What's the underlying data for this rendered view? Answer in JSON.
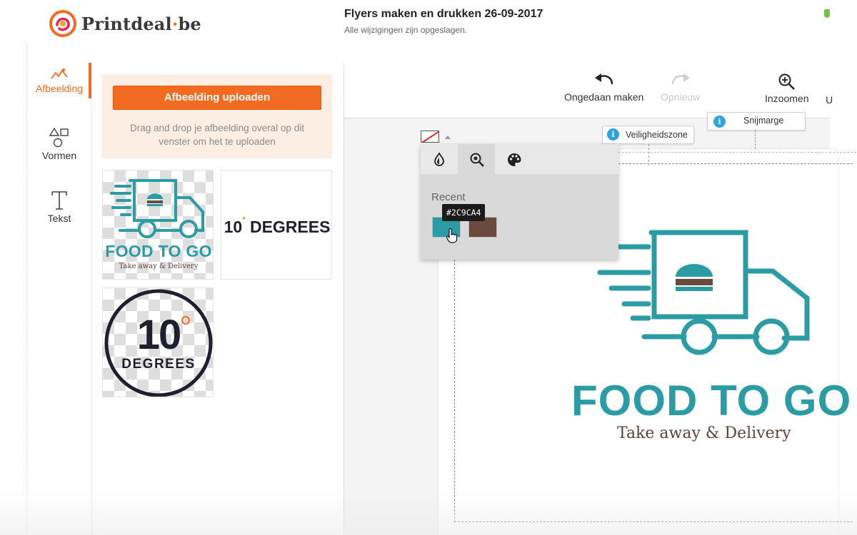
{
  "brand": {
    "name": "Printdeal",
    "separator": "·",
    "tld": "be"
  },
  "document": {
    "title": "Flyers maken en drukken 26-09-2017",
    "status": "Alle wijzigingen zijn opgeslagen."
  },
  "nav": {
    "items": [
      {
        "label": "Afbeelding",
        "icon": "image-icon",
        "active": true
      },
      {
        "label": "Vormen",
        "icon": "shapes-icon",
        "active": false
      },
      {
        "label": "Tekst",
        "icon": "text-icon",
        "active": false
      }
    ]
  },
  "upload": {
    "button_label": "Afbeelding uploaden",
    "hint": "Drag and drop je afbeelding overal op dit venster om het te uploaden"
  },
  "thumbnails": [
    {
      "kind": "food-to-go",
      "title": "FOOD TO GO",
      "subtitle": "Take away & Delivery"
    },
    {
      "kind": "degrees-wordmark",
      "number": "10",
      "word": "DEGREES"
    },
    {
      "kind": "degrees-badge",
      "number": "10",
      "word": "DEGREES"
    }
  ],
  "toolbar": {
    "undo_label": "Ongedaan maken",
    "redo_label": "Opnieuw",
    "zoom_in_label": "Inzoomen",
    "cut_partial": "U"
  },
  "guides": {
    "safe_zone": "Veiligheidszone",
    "bleed": "Snijmarge"
  },
  "color_picker": {
    "tabs": [
      {
        "icon": "droplet-icon",
        "selected": false
      },
      {
        "icon": "eyedropper-zoom-icon",
        "selected": true
      },
      {
        "icon": "palette-icon",
        "selected": false
      }
    ],
    "recent_label": "Recent",
    "recent_colors": [
      "#2C9CA4",
      "#6B4A3E"
    ],
    "tooltip": "#2C9CA4"
  },
  "canvas_logo": {
    "title": "FOOD TO GO",
    "subtitle": "Take away & Delivery"
  },
  "colors": {
    "accent": "#F36B21",
    "teal": "#2C9CA4",
    "brown": "#6B4A3E",
    "info": "#2EA3E0"
  }
}
